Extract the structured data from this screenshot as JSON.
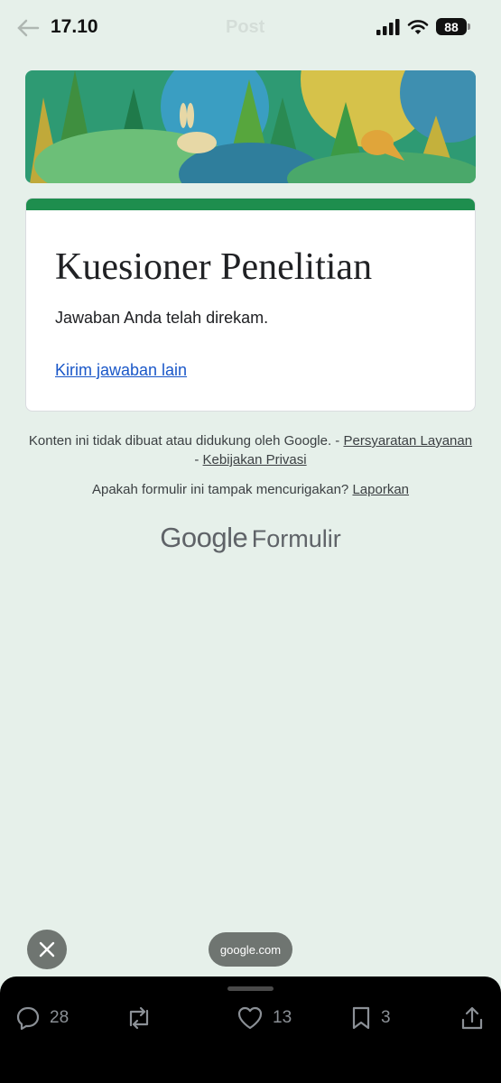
{
  "status_bar": {
    "time": "17.10",
    "battery": "88",
    "background_title": "Post"
  },
  "form": {
    "title": "Kuesioner Penelitian",
    "message": "Jawaban Anda telah direkam.",
    "resubmit_link": "Kirim jawaban lain",
    "accent_color": "#1e8e4e"
  },
  "footer": {
    "disclaimer": "Konten ini tidak dibuat atau didukung oleh Google. - ",
    "terms_link": "Persyaratan Layanan",
    "separator": " - ",
    "privacy_link": "Kebijakan Privasi",
    "report_prompt": "Apakah formulir ini tampak mencurigakan? ",
    "report_link": "Laporkan",
    "brand_google": "Google",
    "brand_product": "Formulir"
  },
  "browser_overlay": {
    "domain": "google.com"
  },
  "actions": {
    "replies": "28",
    "likes": "13",
    "bookmarks": "3"
  }
}
